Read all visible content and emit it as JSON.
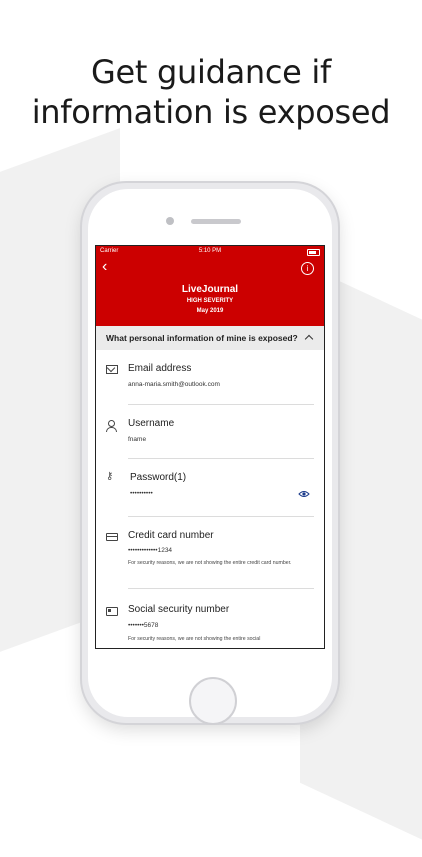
{
  "headline": {
    "line1": "Get guidance if",
    "line2": "information is exposed"
  },
  "status_bar": {
    "carrier": "Carrier",
    "time": "5:10 PM"
  },
  "header": {
    "title": "LiveJournal",
    "severity": "HIGH SEVERITY",
    "date": "May 2019",
    "back_icon": "chevron-left-icon",
    "info_icon": "info-icon"
  },
  "question": {
    "text": "What personal information of mine is exposed?"
  },
  "items": [
    {
      "label": "Email address",
      "value": "anna-maria.smith@outlook.com",
      "icon": "envelope-icon"
    },
    {
      "label": "Username",
      "value": "fname",
      "icon": "user-icon"
    },
    {
      "label": "Password(1)",
      "value": "••••••••••",
      "icon": "key-icon",
      "action_icon": "eye-icon"
    },
    {
      "label": "Credit card number",
      "value": "•••••••••••••1234",
      "note": "For security reasons, we are not showing the entire credit card number.",
      "icon": "credit-card-icon"
    },
    {
      "label": "Social security number",
      "value": "•••••••5678",
      "note": "For security reasons, we are not showing the entire social",
      "icon": "id-card-icon"
    }
  ],
  "colors": {
    "header_bg": "#cc0000",
    "eye_icon": "#1a3a8a"
  }
}
